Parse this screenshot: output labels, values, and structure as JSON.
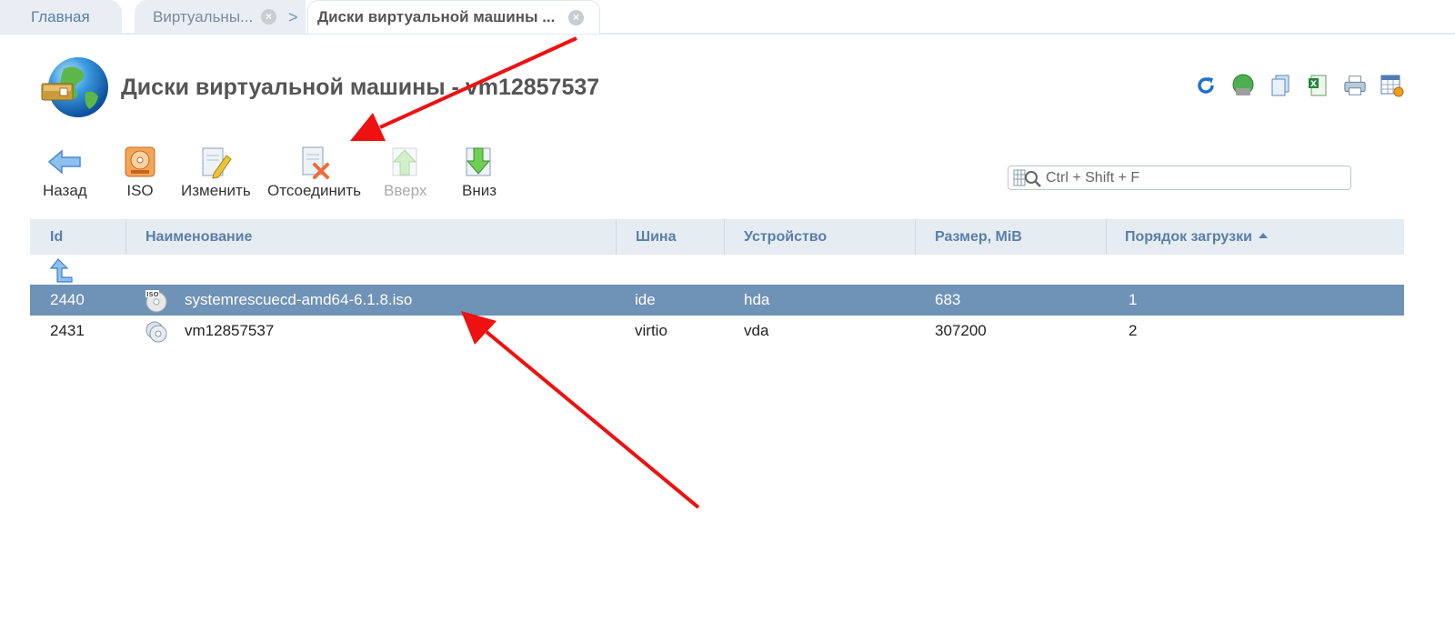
{
  "tabs": {
    "home": "Главная",
    "vm": "Виртуальны...",
    "active": "Диски виртуальной машины ..."
  },
  "page": {
    "title": "Диски виртуальной машины - vm12857537"
  },
  "toolbar": {
    "back": "Назад",
    "iso": "ISO",
    "edit": "Изменить",
    "detach": "Отсоединить",
    "up": "Вверх",
    "down": "Вниз"
  },
  "search": {
    "placeholder": "Ctrl + Shift + F"
  },
  "table": {
    "columns": {
      "id": "Id",
      "name": "Наименование",
      "bus": "Шина",
      "device": "Устройство",
      "size": "Размер, MiB",
      "boot_order": "Порядок загрузки"
    },
    "rows": [
      {
        "id": "2440",
        "name": "systemrescuecd-amd64-6.1.8.iso",
        "bus": "ide",
        "device": "hda",
        "size": "683",
        "boot_order": "1",
        "selected": true
      },
      {
        "id": "2431",
        "name": "vm12857537",
        "bus": "virtio",
        "device": "vda",
        "size": "307200",
        "boot_order": "2",
        "selected": false
      }
    ]
  },
  "colors": {
    "accent": "#5a7fa8",
    "selected_row": "#6f92b7",
    "header_bg": "#e5ecf2",
    "annotation": "#ee1111"
  }
}
